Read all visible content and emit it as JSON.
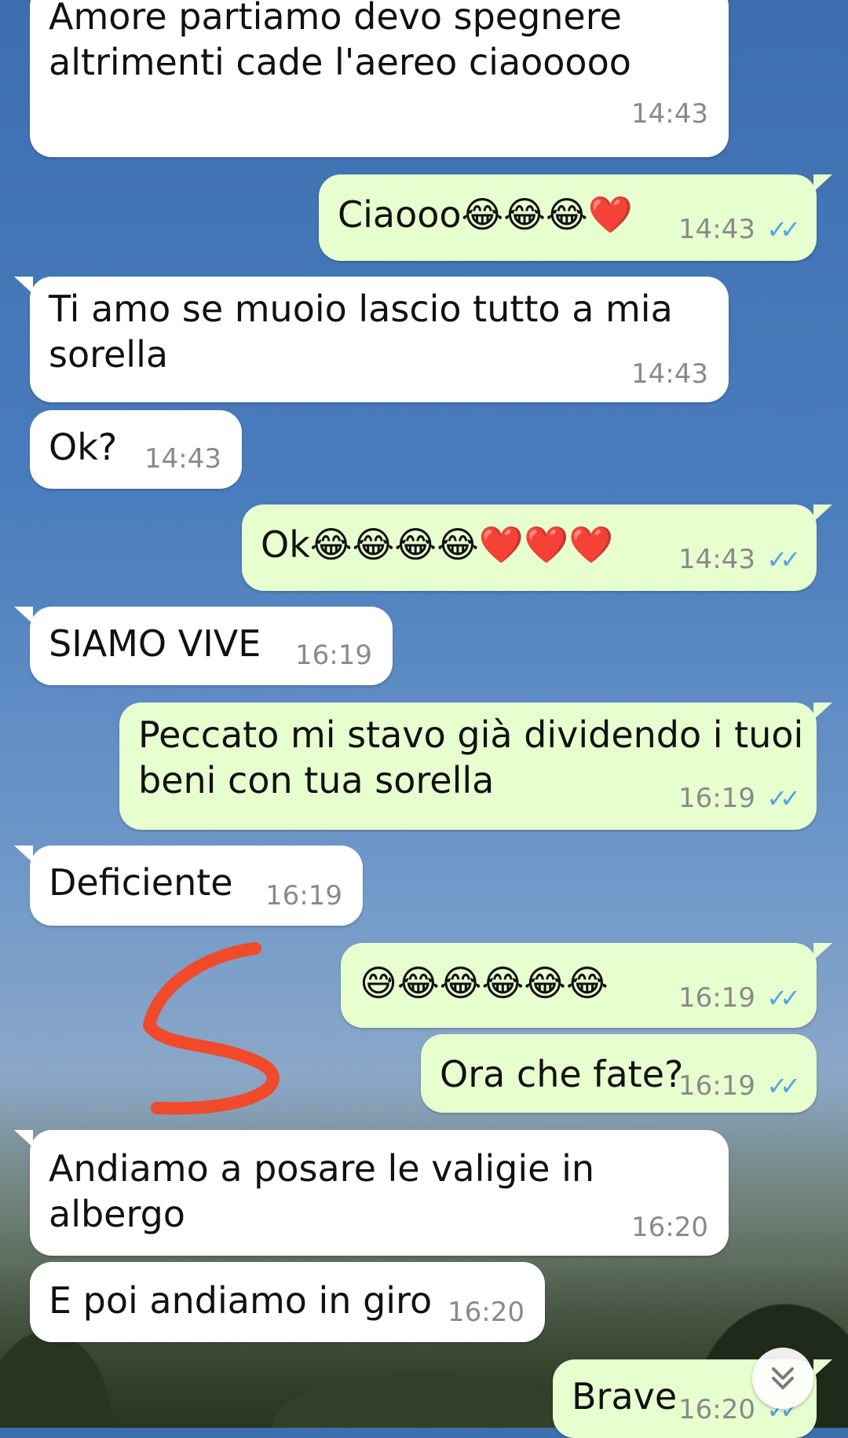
{
  "messages": [
    {
      "text": "Amore partiamo devo spegnere\naltrimenti cade l'aereo ciaooooo",
      "time": "14:43"
    },
    {
      "text": "Ciaooo😂😂😂❤️",
      "time": "14:43"
    },
    {
      "text": "Ti amo se muoio lascio tutto a mia\nsorella",
      "time": "14:43"
    },
    {
      "text": "Ok?",
      "time": "14:43"
    },
    {
      "text": "Ok😂😂😂😂❤️❤️❤️",
      "time": "14:43"
    },
    {
      "text": "SIAMO VIVE",
      "time": "16:19"
    },
    {
      "text": "Peccato mi stavo già dividendo i tuoi\nbeni con tua sorella",
      "time": "16:19"
    },
    {
      "text": "Deficiente",
      "time": "16:19"
    },
    {
      "text": "😅😂😂😂😂😂",
      "time": "16:19"
    },
    {
      "text": "Ora che fate?",
      "time": "16:19"
    },
    {
      "text": "Andiamo a posare le valigie in albergo",
      "time": "16:20"
    },
    {
      "text": "E poi andiamo in giro",
      "time": "16:20"
    },
    {
      "text": "Brave",
      "time": "16:20"
    }
  ],
  "read_receipt": "✓✓",
  "scroll_down_icon": "chevron-double-down-icon",
  "colors": {
    "incoming_bubble": "#ffffff",
    "outgoing_bubble": "#e7fecf",
    "read_ticks": "#4fa3e8",
    "scribble": "#f04a2a"
  }
}
